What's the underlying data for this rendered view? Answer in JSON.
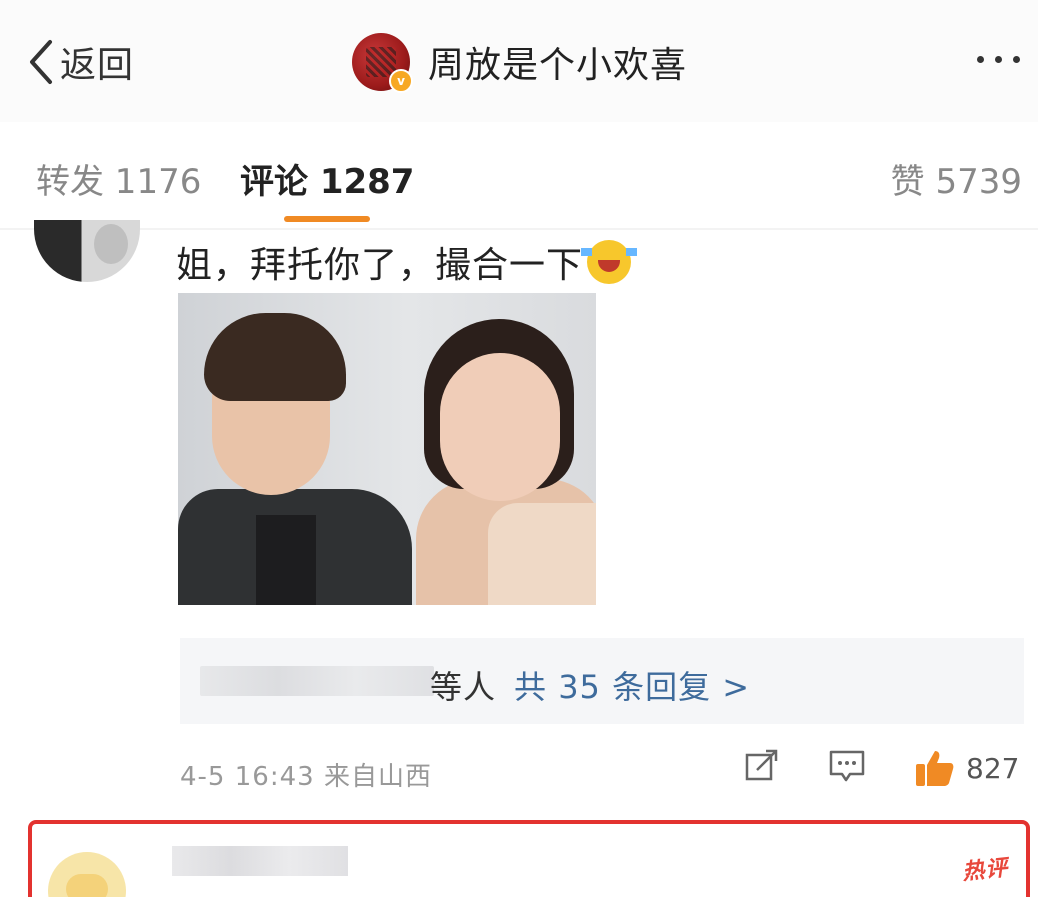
{
  "header": {
    "back_label": "返回",
    "title": "周放是个小欢喜"
  },
  "tabs": {
    "repost": "转发 1176",
    "comment": "评论 1287",
    "like": "赞 5739"
  },
  "comment": {
    "text": "姐，拜托你了，撮合一下",
    "emoji": "laughing-emoji",
    "replies_suffix": "等人",
    "replies_link": "共 35 条回复 >",
    "timestamp": "4-5 16:43",
    "source": "来自山西",
    "like_count": "827"
  },
  "next_comment": {
    "badge": "热评"
  },
  "colors": {
    "accent_orange": "#f08a24",
    "link_blue": "#3e6b9c",
    "highlight_red": "#e3322f",
    "verified_badge": "#f7a824"
  }
}
